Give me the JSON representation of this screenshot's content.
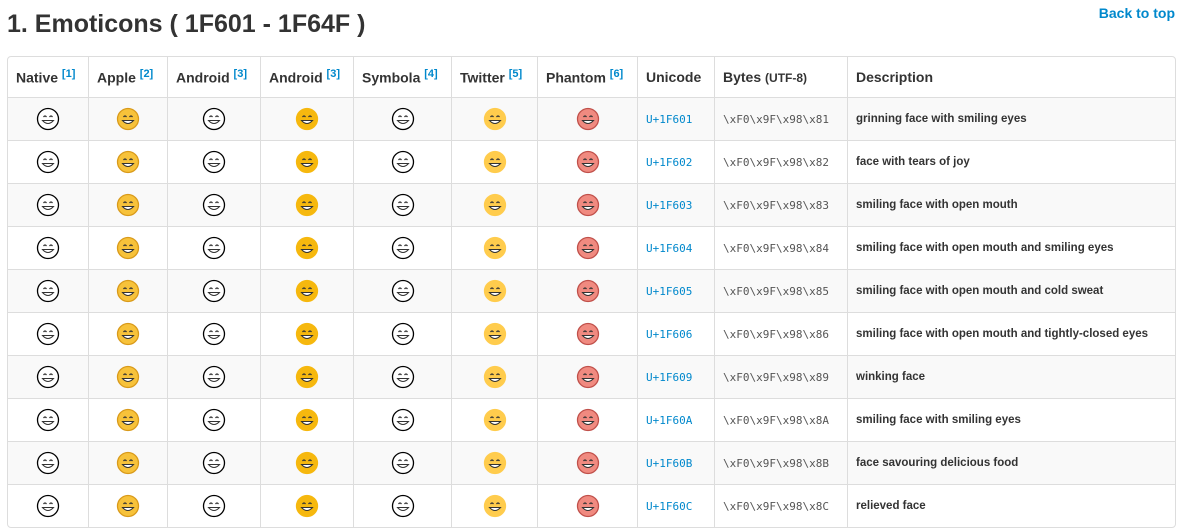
{
  "title": "1. Emoticons ( 1F601 - 1F64F )",
  "back_to_top": "Back to top",
  "columns": [
    {
      "label": "Native",
      "ref": "[1]"
    },
    {
      "label": "Apple",
      "ref": "[2]"
    },
    {
      "label": "Android",
      "ref": "[3]"
    },
    {
      "label": "Android",
      "ref": "[3]"
    },
    {
      "label": "Symbola",
      "ref": "[4]"
    },
    {
      "label": "Twitter",
      "ref": "[5]"
    },
    {
      "label": "Phantom",
      "ref": "[6]"
    },
    {
      "label": "Unicode"
    },
    {
      "label": "Bytes",
      "sub": "(UTF-8)"
    },
    {
      "label": "Description"
    }
  ],
  "column_styles": [
    {
      "fill": "#ffffff",
      "stroke": "#000000"
    },
    {
      "fill": "#f7c23a",
      "stroke": "#d99a1a"
    },
    {
      "fill": "#ffffff",
      "stroke": "#000000"
    },
    {
      "fill": "#f6b80e",
      "stroke": "#f6b80e"
    },
    {
      "fill": "#ffffff",
      "stroke": "#000000"
    },
    {
      "fill": "#ffcc4d",
      "stroke": "#ffcc4d"
    },
    {
      "fill": "#f08a80",
      "stroke": "#c0504a"
    }
  ],
  "rows": [
    {
      "unicode": "U+1F601",
      "bytes": "\\xF0\\x9F\\x98\\x81",
      "desc": "grinning face with smiling eyes"
    },
    {
      "unicode": "U+1F602",
      "bytes": "\\xF0\\x9F\\x98\\x82",
      "desc": "face with tears of joy"
    },
    {
      "unicode": "U+1F603",
      "bytes": "\\xF0\\x9F\\x98\\x83",
      "desc": "smiling face with open mouth"
    },
    {
      "unicode": "U+1F604",
      "bytes": "\\xF0\\x9F\\x98\\x84",
      "desc": "smiling face with open mouth and smiling eyes"
    },
    {
      "unicode": "U+1F605",
      "bytes": "\\xF0\\x9F\\x98\\x85",
      "desc": "smiling face with open mouth and cold sweat"
    },
    {
      "unicode": "U+1F606",
      "bytes": "\\xF0\\x9F\\x98\\x86",
      "desc": "smiling face with open mouth and tightly-closed eyes"
    },
    {
      "unicode": "U+1F609",
      "bytes": "\\xF0\\x9F\\x98\\x89",
      "desc": "winking face"
    },
    {
      "unicode": "U+1F60A",
      "bytes": "\\xF0\\x9F\\x98\\x8A",
      "desc": "smiling face with smiling eyes"
    },
    {
      "unicode": "U+1F60B",
      "bytes": "\\xF0\\x9F\\x98\\x8B",
      "desc": "face savouring delicious food"
    },
    {
      "unicode": "U+1F60C",
      "bytes": "\\xF0\\x9F\\x98\\x8C",
      "desc": "relieved face"
    }
  ]
}
